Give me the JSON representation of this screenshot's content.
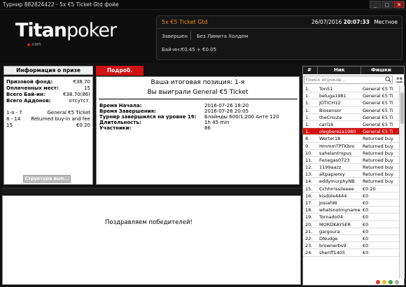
{
  "window": {
    "title": "Турнир 882824422 - 5x €5 Ticket Gtd фойе",
    "min_label": "_",
    "max_label": "□",
    "close_label": "✕"
  },
  "logo": {
    "brand_bold": "Titan",
    "brand_rest": "poker",
    "suffix": ".com"
  },
  "tournament": {
    "name": "5x €5 Ticket Gtd",
    "date": "26/07/2016",
    "time": "20:07:33",
    "time_zone": "Местное",
    "status": "Завершен",
    "limit": "Без Лимита Холдем",
    "buyin": "Бай-ин:€0.45 + €0.05"
  },
  "prize": {
    "header": "Информация о призе",
    "rows": [
      {
        "label": "Призовой фонд:",
        "value": "€38.70"
      },
      {
        "label": "Оплаченных мест:",
        "value": "15"
      },
      {
        "label": "Всего Бай-ин:",
        "value": "€38.70(86)"
      },
      {
        "label": "Всего Аддонов:",
        "value": "отсутст."
      }
    ],
    "places": [
      {
        "place": "1-я - 7",
        "prize": "General €5 Ticket"
      },
      {
        "place": "8 - 14",
        "prize": "Returned buy-in and fee"
      },
      {
        "place": "15",
        "prize": "€0.20"
      }
    ],
    "structure_button": "Структура вып..."
  },
  "tabs": {
    "details": "Подроб."
  },
  "result": {
    "line1": "Ваша итоговая позиция: 1-я",
    "line2": "Вы выиграли General €5 Ticket",
    "rows": [
      {
        "label": "Время Начала:",
        "value": "2016-07-26 18:20"
      },
      {
        "label": "Время Завершения:",
        "value": "2016-07-26 20:05"
      },
      {
        "label": "Турнир завершился на уровне 19:",
        "value": "Блайнды 600/1,200 Анте 120"
      },
      {
        "label": "Длительность:",
        "value": "1h 45 min"
      },
      {
        "label": "Участники:",
        "value": "86"
      }
    ]
  },
  "winner": {
    "message": "Поздравляем победителей!"
  },
  "players": {
    "col_num": "#",
    "col_nick": "Ник",
    "col_chips": "Фишки",
    "search_placeholder": "Поиск игроков...",
    "rows": [
      {
        "n": "1.",
        "nick": "Ton51",
        "chips": "General €5 Ti",
        "hl": false
      },
      {
        "n": "1.",
        "nick": "beluga1981",
        "chips": "General €5 Ti",
        "hl": false
      },
      {
        "n": "1.",
        "nick": "JOTICH12",
        "chips": "General €5 Ti",
        "hl": false
      },
      {
        "n": "1.",
        "nick": "Biosensor",
        "chips": "General €5 Ti",
        "hl": false
      },
      {
        "n": "1.",
        "nick": "theCroute",
        "chips": "General €5 Ti",
        "hl": false
      },
      {
        "n": "1.",
        "nick": "carl16",
        "chips": "General €5 Ti",
        "hl": false
      },
      {
        "n": "1.",
        "nick": "olegbereza1980",
        "chips": "General €5 Ti",
        "hl": true
      },
      {
        "n": "8.",
        "nick": "Werter18",
        "chips": "Returned buy",
        "hl": false
      },
      {
        "n": "9.",
        "nick": "HmmmTPTKbro",
        "chips": "Returned buy",
        "hl": false
      },
      {
        "n": "10.",
        "nick": "sahelantropus",
        "chips": "Returned buy",
        "hl": false
      },
      {
        "n": "11.",
        "nick": "Fenegas0723",
        "chips": "Returned buy",
        "hl": false
      },
      {
        "n": "12.",
        "nick": "1199aazz",
        "chips": "Returned buy",
        "hl": false
      },
      {
        "n": "13.",
        "nick": "altpapierxy",
        "chips": "Returned buy",
        "hl": false
      },
      {
        "n": "14.",
        "nick": "eddymurphyNB",
        "chips": "Returned buy",
        "hl": false
      },
      {
        "n": "15.",
        "nick": "Cchhrrissileeee",
        "chips": "€0.20",
        "hl": false
      },
      {
        "n": "16.",
        "nick": "kisdole4444",
        "chips": "€0",
        "hl": false
      },
      {
        "n": "17.",
        "nick": "JosiahW",
        "chips": "€0",
        "hl": false
      },
      {
        "n": "18.",
        "nick": "whatsnotmyname",
        "chips": "€0",
        "hl": false
      },
      {
        "n": "19.",
        "nick": "Tornado04",
        "chips": "€0",
        "hl": false
      },
      {
        "n": "20.",
        "nick": "MORDKAYSER",
        "chips": "€0",
        "hl": false
      },
      {
        "n": "21.",
        "nick": "gargoura",
        "chips": "€0",
        "hl": false
      },
      {
        "n": "22.",
        "nick": "DNudge",
        "chips": "€0",
        "hl": false
      },
      {
        "n": "23.",
        "nick": "brownerbs9",
        "chips": "€0",
        "hl": false
      },
      {
        "n": "24.",
        "nick": "sheriff1405",
        "chips": "€0",
        "hl": false
      }
    ]
  },
  "colors": {
    "accent_red": "#d41010",
    "tournament_name": "#f08a1c",
    "status_dots": [
      "#d93a2b",
      "#e8c21a",
      "#3aa63a",
      "#aaaaaa"
    ]
  }
}
